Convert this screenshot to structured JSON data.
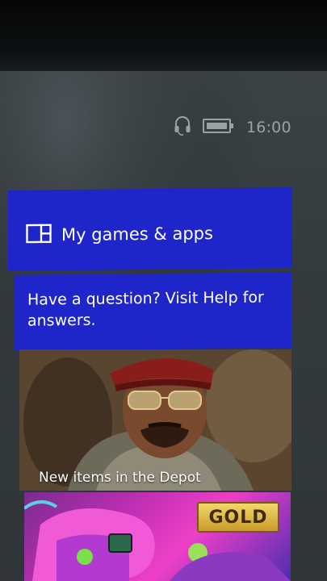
{
  "status": {
    "time": "16:00",
    "headset_icon": "headset-icon",
    "battery_icon": "battery-icon"
  },
  "tiles": {
    "games": {
      "label": "My games & apps",
      "icon": "games-apps-icon"
    },
    "help": {
      "text": "Have a question? Visit Help for answers."
    },
    "depot": {
      "caption": "New items in the Depot"
    },
    "gold": {
      "badge": "GOLD"
    }
  },
  "colors": {
    "tile_blue": "#1f26c9",
    "gold": "#e0b845"
  }
}
